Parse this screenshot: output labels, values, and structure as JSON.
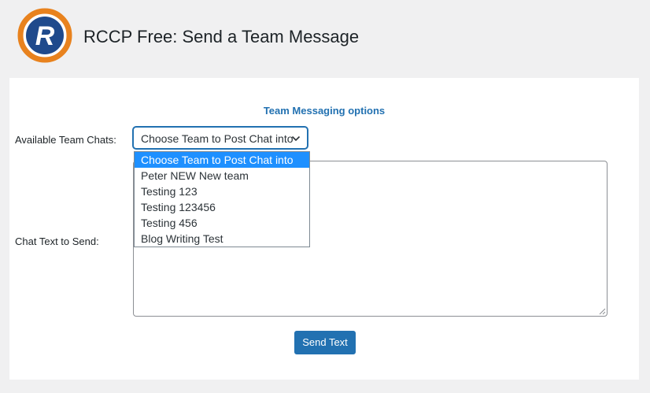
{
  "header": {
    "logo_icon": "rccp-logo-icon",
    "logo_letter": "R",
    "title": "RCCP Free: Send a Team Message"
  },
  "colors": {
    "accent": "#2271b1",
    "logo_ring": "#e8821e",
    "logo_inner": "#1f4a8c",
    "selected_option": "#1e90ff"
  },
  "form": {
    "section_title": "Team Messaging options",
    "team_label": "Available Team Chats:",
    "team_select": {
      "value": "Choose Team to Post Chat into",
      "icon": "chevron-down-icon",
      "options": [
        "Choose Team to Post Chat into",
        "Peter NEW New team",
        "Testing 123",
        "Testing 123456",
        "Testing 456",
        "Blog Writing Test"
      ],
      "selected_index": 0
    },
    "chat_label": "Chat Text to Send:",
    "chat_text": "",
    "send_label": "Send Text"
  }
}
